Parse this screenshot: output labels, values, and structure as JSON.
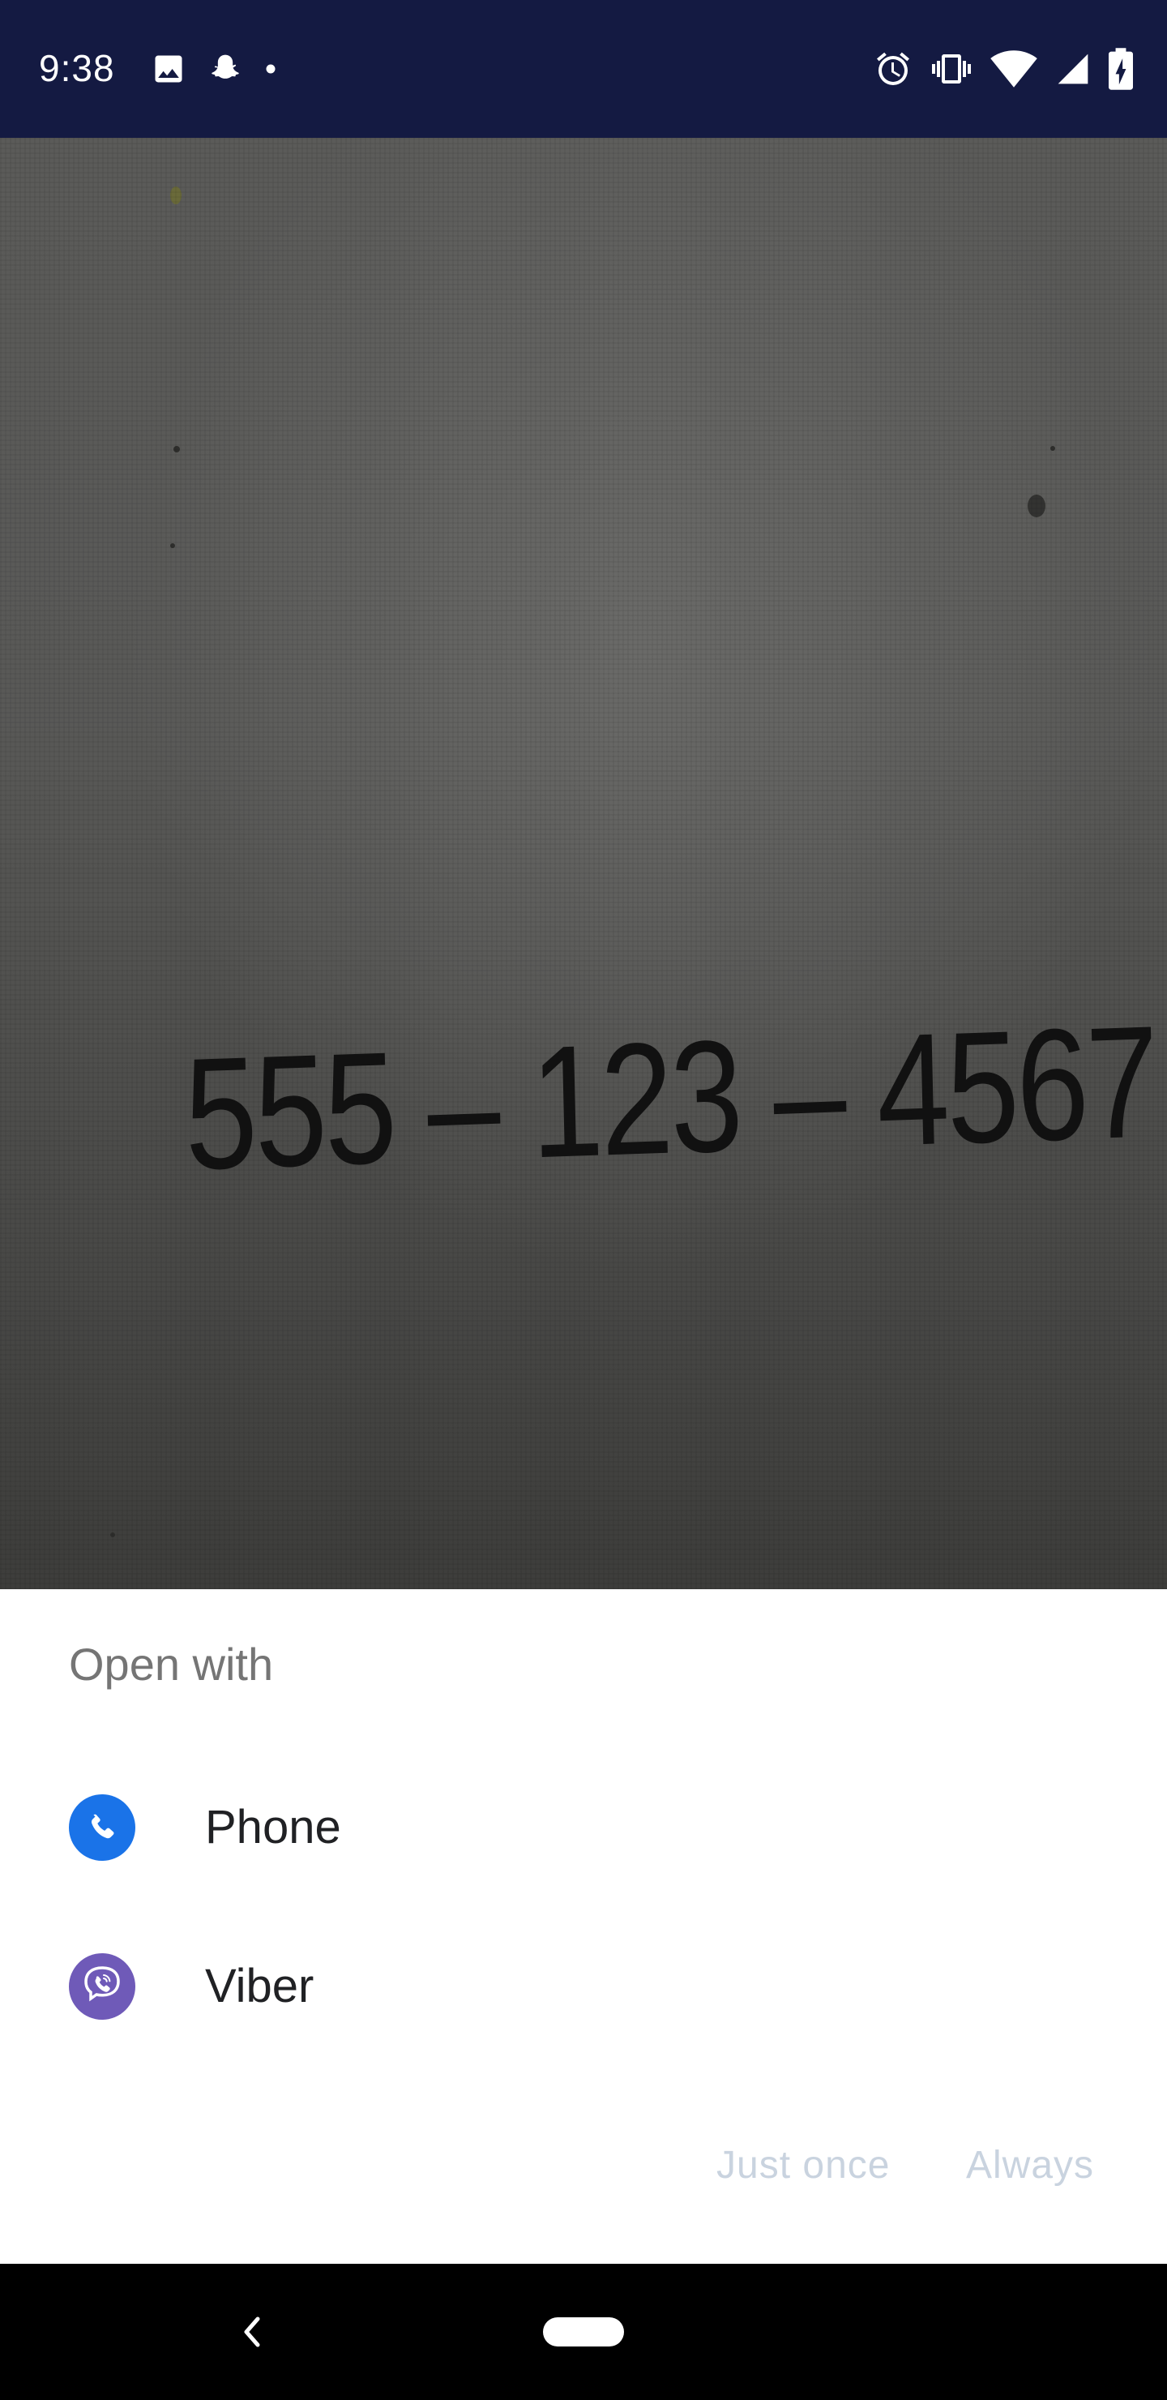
{
  "status_bar": {
    "time": "9:38",
    "left_icons": [
      "image-icon",
      "snapchat-icon",
      "dot-icon"
    ],
    "right_icons": [
      "alarm-icon",
      "vibrate-icon",
      "wifi-icon",
      "cell-signal-icon",
      "battery-charging-icon"
    ]
  },
  "preview": {
    "recognized_number": "555 – 123 – 4567"
  },
  "dialog": {
    "title": "Open with",
    "apps": [
      {
        "label": "Phone",
        "icon": "phone-icon",
        "icon_color": "#1a73e8"
      },
      {
        "label": "Viber",
        "icon": "viber-icon",
        "icon_color": "#6f5ab8"
      }
    ],
    "buttons": {
      "just_once": "Just once",
      "always": "Always"
    }
  },
  "colors": {
    "status_bar_bg": "#141a42",
    "button_disabled_text": "#c9d3df",
    "title_text": "#757575"
  },
  "nav_bar": {
    "icons": [
      "back-icon",
      "home-pill-icon"
    ]
  }
}
